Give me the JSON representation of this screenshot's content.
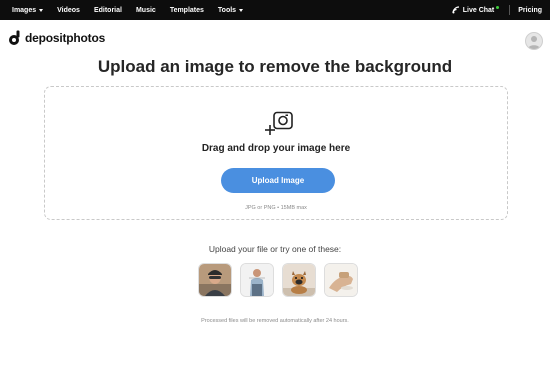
{
  "topbar": {
    "nav": [
      {
        "label": "Images",
        "has_caret": true
      },
      {
        "label": "Videos",
        "has_caret": false
      },
      {
        "label": "Editorial",
        "has_caret": false
      },
      {
        "label": "Music",
        "has_caret": false
      },
      {
        "label": "Templates",
        "has_caret": false
      },
      {
        "label": "Tools",
        "has_caret": true
      }
    ],
    "live_chat": "Live Chat",
    "pricing": "Pricing"
  },
  "brand": {
    "name": "depositphotos"
  },
  "page": {
    "title": "Upload an image to remove the background"
  },
  "dropzone": {
    "drag_text": "Drag and drop your image here",
    "upload_button": "Upload Image",
    "hint": "JPG or PNG • 15MB max"
  },
  "samples": {
    "label": "Upload your file or try one of these:",
    "items": [
      "sample-cyclist",
      "sample-man-in-shirt",
      "sample-dog",
      "sample-hand"
    ]
  },
  "footer": {
    "note": "Processed files will be removed automatically after 24 hours."
  },
  "colors": {
    "topbar": "#0d0d0d",
    "accent": "#4a8fe0",
    "live_dot": "#3ccd3c"
  }
}
